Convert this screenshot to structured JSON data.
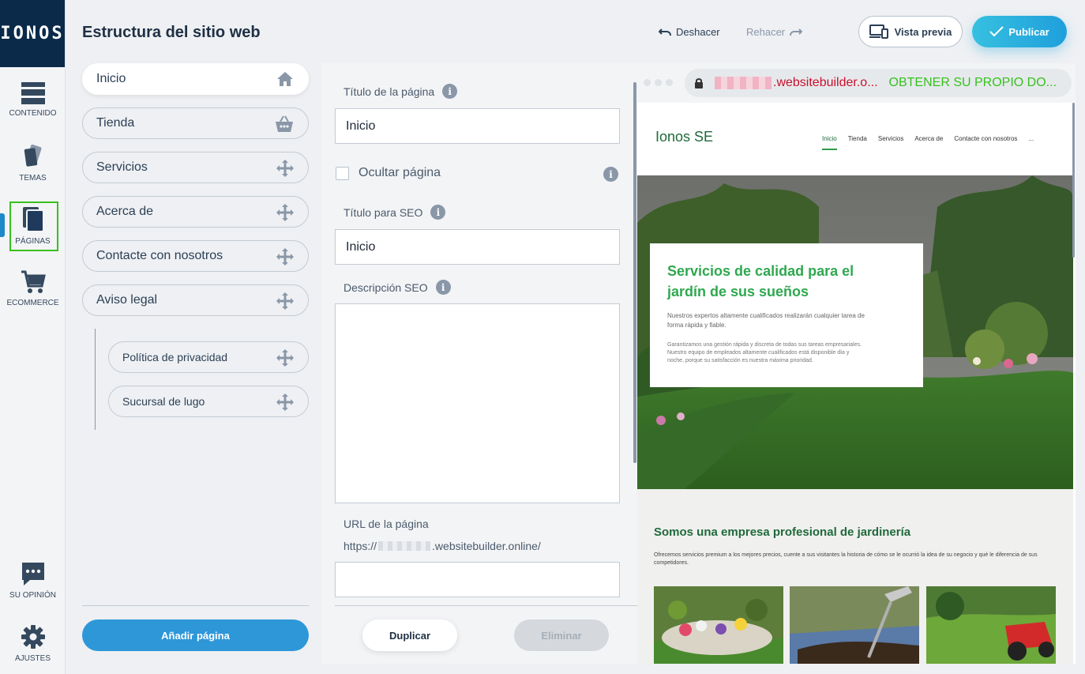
{
  "brand": "IONOS",
  "rail": {
    "items": [
      {
        "id": "contenido",
        "label": "CONTENIDO",
        "icon": "content-icon"
      },
      {
        "id": "temas",
        "label": "TEMAS",
        "icon": "themes-icon"
      },
      {
        "id": "paginas",
        "label": "PÁGINAS",
        "icon": "pages-icon",
        "active": true
      },
      {
        "id": "ecommerce",
        "label": "ECOMMERCE",
        "icon": "cart-icon"
      },
      {
        "id": "opinion",
        "label": "SU OPINIÓN",
        "icon": "chat-icon"
      },
      {
        "id": "ajustes",
        "label": "AJUSTES",
        "icon": "gear-icon"
      }
    ]
  },
  "header": {
    "title": "Estructura del sitio web",
    "undo": "Deshacer",
    "redo": "Rehacer",
    "preview": "Vista previa",
    "publish": "Publicar"
  },
  "pages": [
    {
      "label": "Inicio",
      "icon": "home-icon",
      "active": true
    },
    {
      "label": "Tienda",
      "icon": "basket-icon"
    },
    {
      "label": "Servicios",
      "icon": "move-icon"
    },
    {
      "label": "Acerca de",
      "icon": "move-icon"
    },
    {
      "label": "Contacte con nosotros",
      "icon": "move-icon"
    },
    {
      "label": "Aviso legal",
      "icon": "move-icon"
    },
    {
      "label": "Política de privacidad",
      "icon": "move-icon",
      "sub": true
    },
    {
      "label": "Sucursal de lugo",
      "icon": "move-icon",
      "sub": true
    }
  ],
  "add_page": "Añadir página",
  "form": {
    "page_title_label": "Título de la página",
    "page_title_value": "Inicio",
    "hide_page_label": "Ocultar página",
    "hide_page_checked": false,
    "seo_title_label": "Título para SEO",
    "seo_title_value": "Inicio",
    "seo_desc_label": "Descripción SEO",
    "seo_desc_value": "",
    "url_label": "URL de la página",
    "url_prefix": "https://",
    "url_suffix": ".websitebuilder.online/",
    "url_value": "",
    "duplicate": "Duplicar",
    "delete": "Eliminar"
  },
  "preview_site": {
    "address_domain": ".websitebuilder.o...",
    "address_cta": "OBTENER SU PROPIO DO...",
    "logo": "Ionos SE",
    "nav": [
      "Inicio",
      "Tienda",
      "Servicios",
      "Acerca de",
      "Contacte con nosotros",
      "..."
    ],
    "hero_title": "Servicios de calidad para el jardín de sus sueños",
    "hero_p1": "Nuestros expertos altamente cualificados realizarán cualquier tarea de forma rápida y fiable.",
    "hero_p2": "Garantizamos una gestión rápida y discreta de todas sus tareas empresariales. Nuestro equipo de empleados altamente cualificados está disponible día y noche, porque su satisfacción es nuestra máxima prioridad.",
    "section_title": "Somos una empresa profesional de jardinería",
    "section_text": "Ofrecemos servicios premium a los mejores precios, cuente a sus visitantes la historia de cómo se le ocurrió la idea de su negocio y qué le diferencia de sus competidores."
  },
  "colors": {
    "accent": "#2e97d8",
    "active_outline": "#36c11e",
    "brand_dark": "#0b2a4a",
    "site_green": "#2fa84f"
  }
}
